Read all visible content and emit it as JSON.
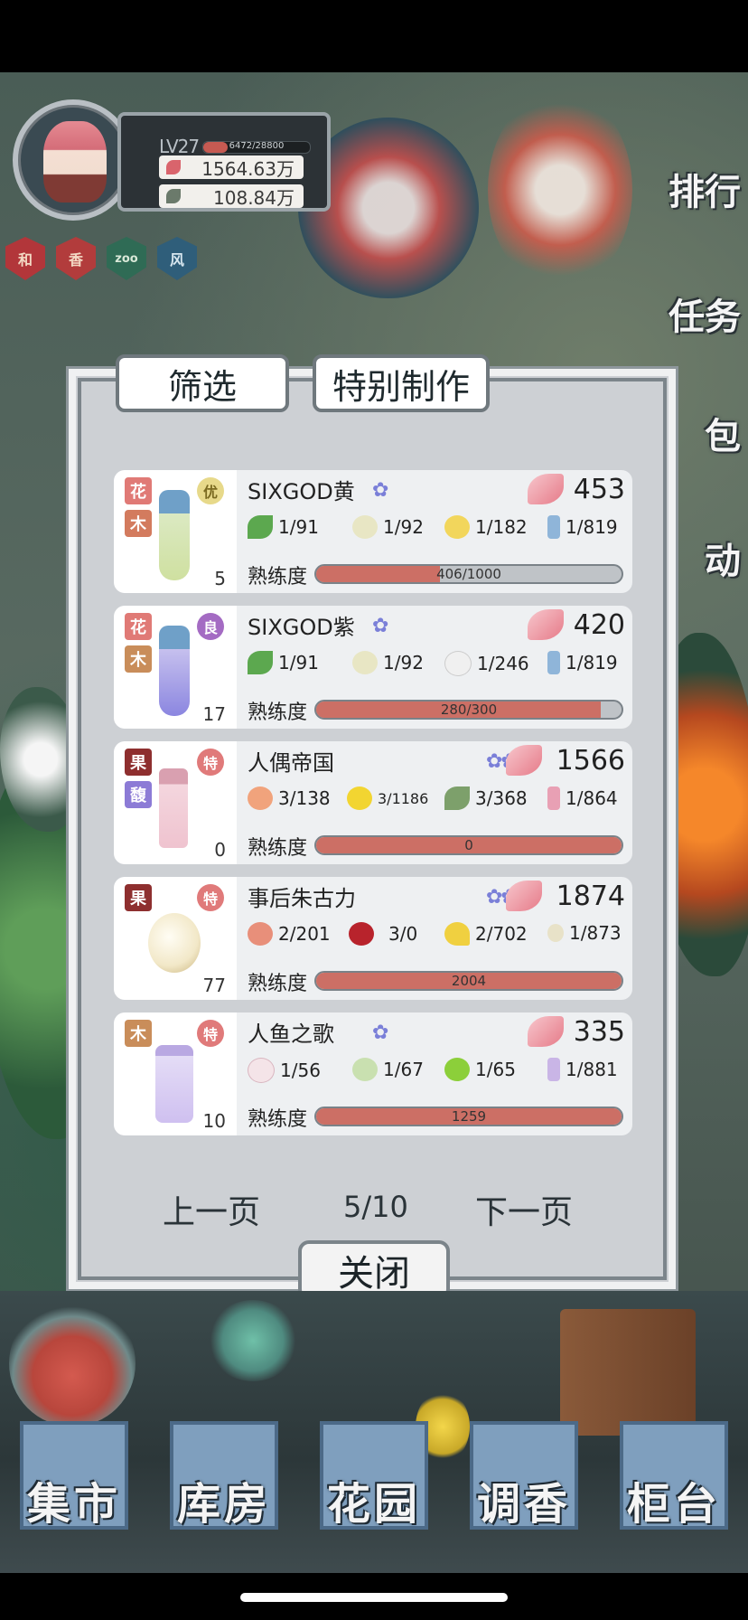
{
  "profile": {
    "level": "LV27",
    "xp": "6472/28800",
    "xp_fraction": 0.225,
    "petals": "1564.63万",
    "leaves": "108.84万",
    "badges": [
      {
        "label": "和",
        "bg": "#b2363a",
        "fg": "#f3d9c4"
      },
      {
        "label": "香",
        "bg": "#b23c3c",
        "fg": "#f3d9c4"
      },
      {
        "label": "zoo",
        "bg": "#2f6b55",
        "fg": "#d9e8d8"
      },
      {
        "label": "风",
        "bg": "#2f5e7a",
        "fg": "#d7e6ef"
      }
    ]
  },
  "side_menu": {
    "rank": "排行",
    "tasks": "任务",
    "bag": "包",
    "events": "动"
  },
  "dialog": {
    "tab_filter": "筛选",
    "tab_special": "特别制作",
    "proficiency_label": "熟练度",
    "prev_page": "上一页",
    "page": "5/10",
    "next_page": "下一页",
    "close": "关闭"
  },
  "recipes": [
    {
      "name": "SIXGOD黄",
      "stars": "✿",
      "price": "453",
      "count": "5",
      "tags": [
        {
          "label": "花",
          "bg": "#e07a76"
        },
        {
          "label": "木",
          "bg": "#d37b5e"
        }
      ],
      "grade": {
        "label": "优",
        "bg": "#e7d98a",
        "fg": "#7a6a20"
      },
      "bottle": "yellow-green",
      "ingredients": [
        {
          "icon": "mint-leaf-icon",
          "color": "#5ca84f",
          "text": "1/91"
        },
        {
          "icon": "lily-icon",
          "color": "#e8e6c4",
          "text": "1/92"
        },
        {
          "icon": "yellow-flower-icon",
          "color": "#f2d65c",
          "text": "1/182"
        },
        {
          "icon": "bottle-icon",
          "color": "#8fb5d9",
          "text": "1/819"
        }
      ],
      "proficiency": "406/1000",
      "proficiency_fraction": 0.406
    },
    {
      "name": "SIXGOD紫",
      "stars": "✿",
      "price": "420",
      "count": "17",
      "tags": [
        {
          "label": "花",
          "bg": "#e07a76"
        },
        {
          "label": "木",
          "bg": "#c98d5a"
        }
      ],
      "grade": {
        "label": "良",
        "bg": "#a46bc3",
        "fg": "#ffffff"
      },
      "bottle": "purple",
      "ingredients": [
        {
          "icon": "mint-leaf-icon",
          "color": "#5ca84f",
          "text": "1/91"
        },
        {
          "icon": "lily-icon",
          "color": "#e8e6c4",
          "text": "1/92"
        },
        {
          "icon": "white-flower-icon",
          "color": "#f0f0f0",
          "text": "1/246"
        },
        {
          "icon": "bottle-icon",
          "color": "#8fb5d9",
          "text": "1/819"
        }
      ],
      "proficiency": "280/300",
      "proficiency_fraction": 0.933
    },
    {
      "name": "人偶帝国",
      "stars": "✿✿✿",
      "price": "1566",
      "count": "0",
      "tags": [
        {
          "label": "果",
          "bg": "#8e2f2f"
        },
        {
          "label": "馥",
          "bg": "#8c7bd6"
        }
      ],
      "grade": {
        "label": "特",
        "bg": "#e07a7a",
        "fg": "#ffffff"
      },
      "bottle": "pink",
      "ingredients": [
        {
          "icon": "peach-icon",
          "color": "#f1a37c",
          "text": "3/138"
        },
        {
          "icon": "lemon-icon",
          "color": "#f2d531",
          "text": "3/1186"
        },
        {
          "icon": "rosemary-icon",
          "color": "#7da06b",
          "text": "3/368"
        },
        {
          "icon": "pink-bottle-icon",
          "color": "#e8a0b4",
          "text": "1/864"
        }
      ],
      "proficiency": "0",
      "proficiency_fraction": 1.0
    },
    {
      "name": "事后朱古力",
      "stars": "✿✿",
      "price": "1874",
      "count": "77",
      "tags": [
        {
          "label": "果",
          "bg": "#8e2f2f"
        }
      ],
      "grade": {
        "label": "特",
        "bg": "#e07a7a",
        "fg": "#ffffff"
      },
      "bottle": "round-gold",
      "ingredients": [
        {
          "icon": "rose-icon",
          "color": "#e88f7a",
          "text": "2/201"
        },
        {
          "icon": "berries-icon",
          "color": "#b8232c",
          "text": "3/0"
        },
        {
          "icon": "banana-icon",
          "color": "#f0d040",
          "text": "2/702"
        },
        {
          "icon": "small-bottle-icon",
          "color": "#e8e2c8",
          "text": "1/873"
        }
      ],
      "proficiency": "2004",
      "proficiency_fraction": 1.0
    },
    {
      "name": "人鱼之歌",
      "stars": "✿",
      "price": "335",
      "count": "10",
      "tags": [
        {
          "label": "木",
          "bg": "#c98d5a"
        }
      ],
      "grade": {
        "label": "特",
        "bg": "#e07a7a",
        "fg": "#ffffff"
      },
      "bottle": "lavender",
      "ingredients": [
        {
          "icon": "lotus-icon",
          "color": "#f4e4e8",
          "text": "1/56"
        },
        {
          "icon": "green-flower-icon",
          "color": "#c9e0b0",
          "text": "1/67"
        },
        {
          "icon": "lime-icon",
          "color": "#8ccf3a",
          "text": "1/65"
        },
        {
          "icon": "purple-bottle-icon",
          "color": "#c9b5e6",
          "text": "1/881"
        }
      ],
      "proficiency": "1259",
      "proficiency_fraction": 1.0
    }
  ],
  "bottom_nav": {
    "market": "集市",
    "warehouse": "库房",
    "garden": "花园",
    "blend": "调香",
    "counter": "柜台"
  }
}
